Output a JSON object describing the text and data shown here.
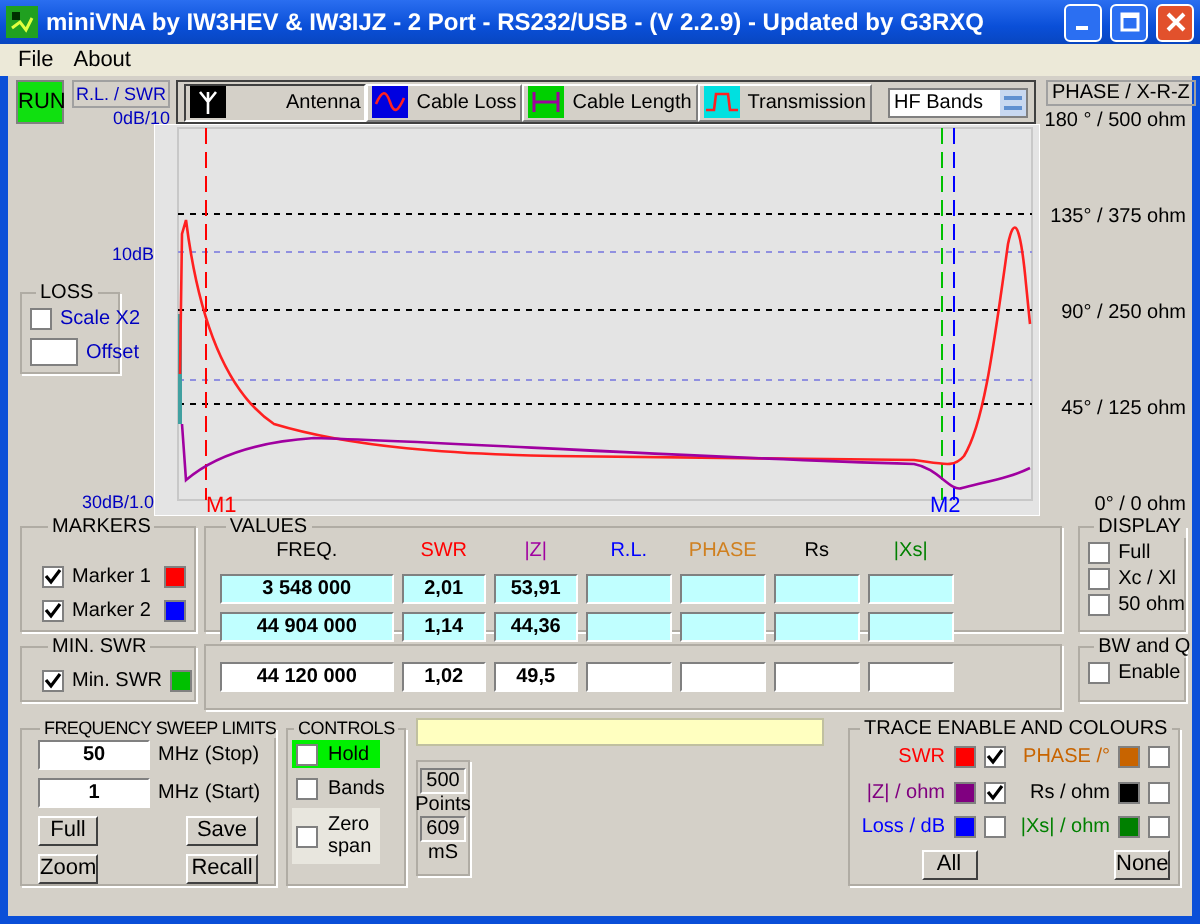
{
  "window": {
    "title": "miniVNA by IW3HEV & IW3IJZ - 2 Port - RS232/USB -  (V 2.2.9) - Updated by G3RXQ"
  },
  "menu": [
    "File",
    "About"
  ],
  "run_button": "RUN",
  "left_axis": {
    "title": "R.L. / SWR",
    "top": "0dB/10",
    "middle": "10dB",
    "bottom": "30dB/1.0"
  },
  "tabs": [
    {
      "label": "Antenna",
      "kind": "antenna",
      "selected": true
    },
    {
      "label": "Cable Loss",
      "kind": "loss",
      "selected": false
    },
    {
      "label": "Cable Length",
      "kind": "length",
      "selected": false
    },
    {
      "label": "Transmission",
      "kind": "transmission",
      "selected": false
    }
  ],
  "band_select": {
    "value": "HF Bands"
  },
  "right_axis": {
    "title": "PHASE / X-R-Z",
    "labels": [
      "180 ° / 500 ohm",
      "135° / 375 ohm",
      "90° / 250 ohm",
      "45° / 125 ohm",
      "0° / 0 ohm"
    ]
  },
  "loss": {
    "title": "LOSS",
    "scale": {
      "label": "Scale X2",
      "checked": false
    },
    "offset": {
      "label": "Offset"
    }
  },
  "plot": {
    "marker_labels": [
      "M1",
      "M2"
    ]
  },
  "markers": {
    "title": "MARKERS",
    "items": [
      {
        "label": "Marker 1",
        "checked": true,
        "color": "#ff0000"
      },
      {
        "label": "Marker 2",
        "checked": true,
        "color": "#0000ff"
      }
    ]
  },
  "values": {
    "title": "VALUES",
    "columns": [
      {
        "label": "FREQ.",
        "color": "#000000"
      },
      {
        "label": "SWR",
        "color": "#ff0000"
      },
      {
        "label": "|Z|",
        "color": "#a000a0"
      },
      {
        "label": "R.L.",
        "color": "#0000ff"
      },
      {
        "label": "PHASE",
        "color": "#d08020"
      },
      {
        "label": "Rs",
        "color": "#000000"
      },
      {
        "label": "|Xs|",
        "color": "#008000"
      }
    ],
    "rows": [
      [
        "3 548 000",
        "2,01",
        "53,91",
        "",
        "",
        "",
        ""
      ],
      [
        "44 904 000",
        "1,14",
        "44,36",
        "",
        "",
        "",
        ""
      ]
    ]
  },
  "min_swr": {
    "title": "MIN. SWR",
    "label": "Min. SWR",
    "checked": true,
    "color": "#00c000",
    "cells": [
      "44 120 000",
      "1,02",
      "49,5",
      "",
      "",
      "",
      ""
    ]
  },
  "display": {
    "title": "DISPLAY",
    "options": [
      {
        "label": "Full",
        "checked": false
      },
      {
        "label": "Xc / Xl",
        "checked": false
      },
      {
        "label": "50 ohm",
        "checked": false
      }
    ]
  },
  "bw_q": {
    "title": "BW and Q",
    "options": [
      {
        "label": "Enable",
        "checked": false
      }
    ]
  },
  "sweep": {
    "title": "FREQUENCY SWEEP LIMITS",
    "stop": {
      "value": "50",
      "unit": "MHz (Stop)"
    },
    "start": {
      "value": "1",
      "unit": "MHz (Start)"
    },
    "buttons": [
      "Full",
      "Save",
      "Zoom",
      "Recall"
    ]
  },
  "controls": {
    "title": "CONTROLS",
    "items": [
      {
        "label": "Hold",
        "checked": false,
        "highlighted": true
      },
      {
        "label": "Bands",
        "checked": false,
        "highlighted": false
      },
      {
        "label": "Zero span",
        "checked": false,
        "highlighted": false
      }
    ]
  },
  "timing": {
    "points": "500",
    "points_label": "Points",
    "time": "609",
    "time_label": "mS"
  },
  "traces": {
    "title": "TRACE ENABLE AND COLOURS",
    "items": [
      {
        "label": "SWR",
        "color": "#ff0000",
        "checked": true
      },
      {
        "label": "PHASE /°",
        "color": "#c86400",
        "checked": false
      },
      {
        "label": "|Z| / ohm",
        "color": "#800080",
        "checked": true
      },
      {
        "label": "Rs / ohm",
        "color": "#000000",
        "checked": false
      },
      {
        "label": "Loss / dB",
        "color": "#0000ff",
        "checked": false
      },
      {
        "label": "|Xs| / ohm",
        "color": "#008000",
        "checked": false
      }
    ],
    "buttons": [
      "All",
      "None"
    ]
  }
}
